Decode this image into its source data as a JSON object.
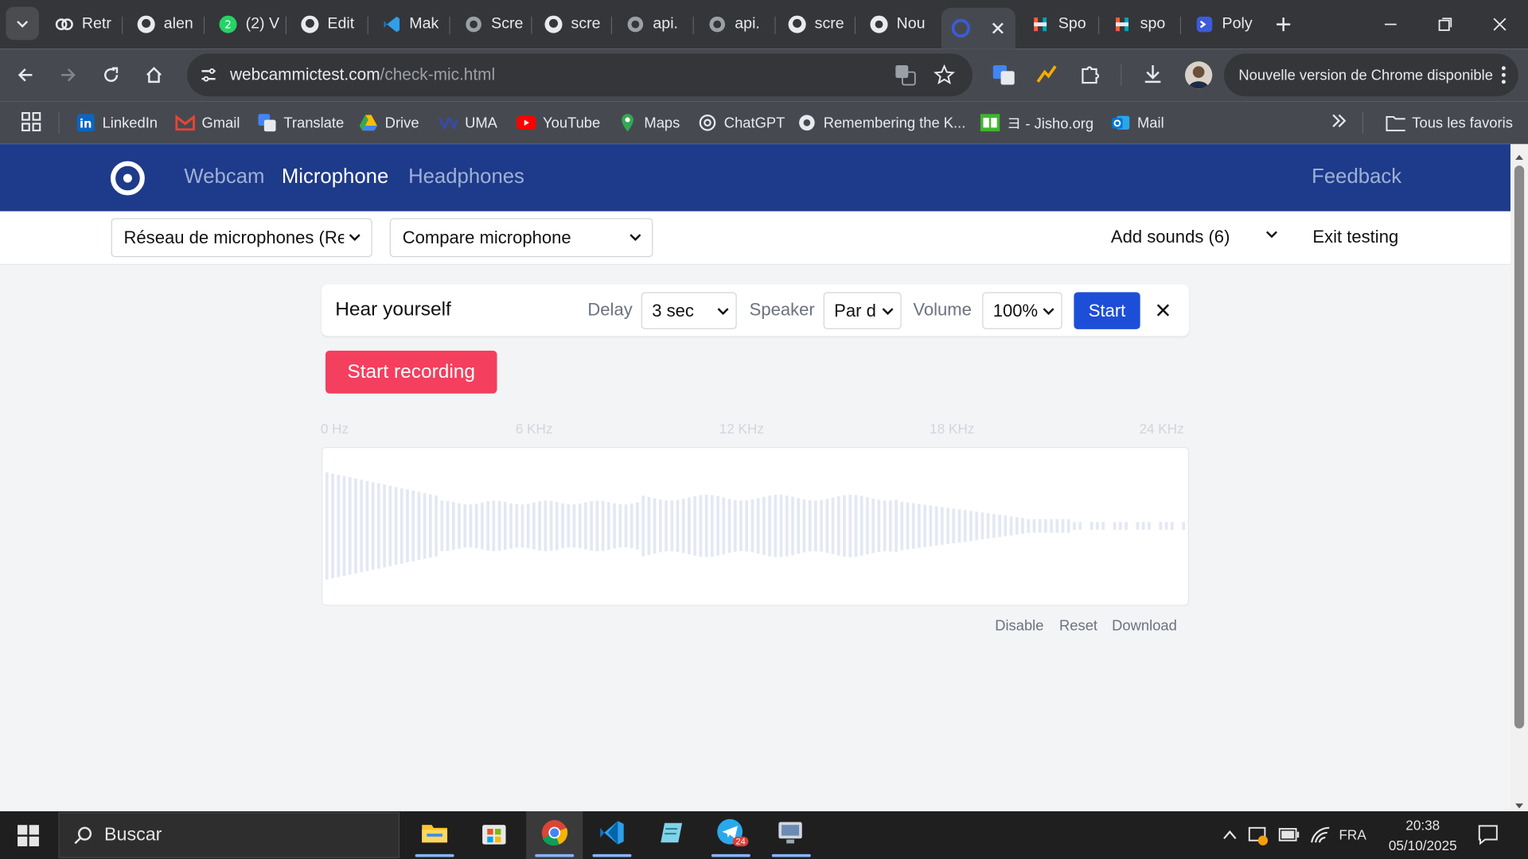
{
  "browser": {
    "tabs": [
      {
        "title": "Retr",
        "icon": "copilot-icon"
      },
      {
        "title": "alen",
        "icon": "github-icon"
      },
      {
        "title": "(2) V",
        "icon": "whatsapp-icon"
      },
      {
        "title": "Edit",
        "icon": "github-icon"
      },
      {
        "title": "Mak",
        "icon": "vscode-icon"
      },
      {
        "title": "Scre",
        "icon": "globe-icon"
      },
      {
        "title": "scre",
        "icon": "github-icon"
      },
      {
        "title": "api.",
        "icon": "globe-icon"
      },
      {
        "title": "api.",
        "icon": "globe-icon"
      },
      {
        "title": "scre",
        "icon": "github-icon"
      },
      {
        "title": "Nou",
        "icon": "chrome-icon"
      },
      {
        "title": "",
        "icon": "webcammictest-icon",
        "active": true
      },
      {
        "title": "Spo",
        "icon": "hubspot-icon"
      },
      {
        "title": "spo",
        "icon": "hubspot-icon"
      },
      {
        "title": "Poly",
        "icon": "poly-icon"
      }
    ],
    "url_domain": "webcammictest.com",
    "url_path": "/check-mic.html",
    "update_label": "Nouvelle version de Chrome disponible",
    "bookmarks": [
      {
        "label": "LinkedIn",
        "icon": "linkedin-icon"
      },
      {
        "label": "Gmail",
        "icon": "gmail-icon"
      },
      {
        "label": "Translate",
        "icon": "translate-icon"
      },
      {
        "label": "Drive",
        "icon": "drive-icon"
      },
      {
        "label": "UMA",
        "icon": "uma-icon"
      },
      {
        "label": "YouTube",
        "icon": "youtube-icon"
      },
      {
        "label": "Maps",
        "icon": "maps-icon"
      },
      {
        "label": "ChatGPT",
        "icon": "chatgpt-icon"
      },
      {
        "label": "Remembering the K...",
        "icon": "globe-icon"
      },
      {
        "label": "ヨ - Jisho.org",
        "icon": "jisho-icon"
      },
      {
        "label": "Mail",
        "icon": "outlook-icon"
      }
    ],
    "all_bookmarks_label": "Tous les favoris"
  },
  "site": {
    "nav": {
      "webcam": "Webcam",
      "microphone": "Microphone",
      "headphones": "Headphones",
      "feedback": "Feedback"
    },
    "mic_select": "Réseau de microphones (Re",
    "compare_select": "Compare microphone",
    "add_sounds": "Add sounds (6)",
    "exit_testing": "Exit testing",
    "hear": {
      "title": "Hear yourself",
      "delay_label": "Delay",
      "delay_value": "3 sec",
      "speaker_label": "Speaker",
      "speaker_value": "Par d",
      "volume_label": "Volume",
      "volume_value": "100%",
      "start": "Start"
    },
    "start_recording": "Start recording",
    "freq_labels": [
      "0 Hz",
      "6 KHz",
      "12 KHz",
      "18 KHz",
      "24 KHz"
    ],
    "links": {
      "disable": "Disable",
      "reset": "Reset",
      "download": "Download"
    }
  },
  "taskbar": {
    "search_placeholder": "Buscar",
    "apps": [
      "file-explorer-icon",
      "microsoft-store-icon",
      "chrome-icon",
      "vscode-icon",
      "notepad-icon",
      "telegram-icon",
      "remote-desktop-icon"
    ],
    "telegram_badge": "24",
    "lang": "FRA",
    "time": "20:38",
    "date": "05/10/2025"
  },
  "colors": {
    "site_nav": "#1e3a8a",
    "start_button": "#1d4ed8",
    "record_button": "#f43f5e"
  }
}
